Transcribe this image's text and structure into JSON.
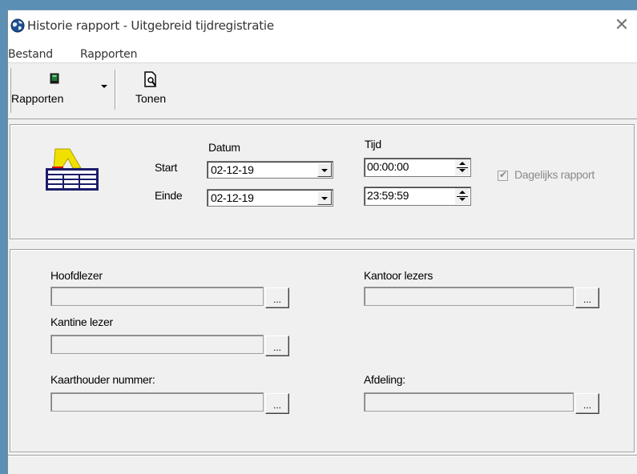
{
  "window": {
    "title": "Historie rapport - Uitgebreid tijdregistratie",
    "close_glyph": "✕"
  },
  "menu": {
    "items": [
      "Bestand",
      "Rapporten"
    ]
  },
  "toolbar": {
    "rapporten_label": "Rapporten",
    "tonen_label": "Tonen"
  },
  "date_panel": {
    "datum_label": "Datum",
    "tijd_label": "Tijd",
    "start_label": "Start",
    "einde_label": "Einde",
    "start_date": "02-12-19",
    "einde_date": "02-12-19",
    "start_time": "00:00:00",
    "einde_time": "23:59:59",
    "daily_report_label": "Dagelijks rapport",
    "daily_report_checked": true
  },
  "filter_panel": {
    "hoofdlezer_label": "Hoofdlezer",
    "hoofdlezer_value": "",
    "kantoor_label": "Kantoor lezers",
    "kantoor_value": "",
    "kantine_label": "Kantine lezer",
    "kantine_value": "",
    "kaarthouder_label": "Kaarthouder nummer:",
    "kaarthouder_value": "",
    "afdeling_label": "Afdeling:",
    "afdeling_value": "",
    "browse_label": "..."
  }
}
